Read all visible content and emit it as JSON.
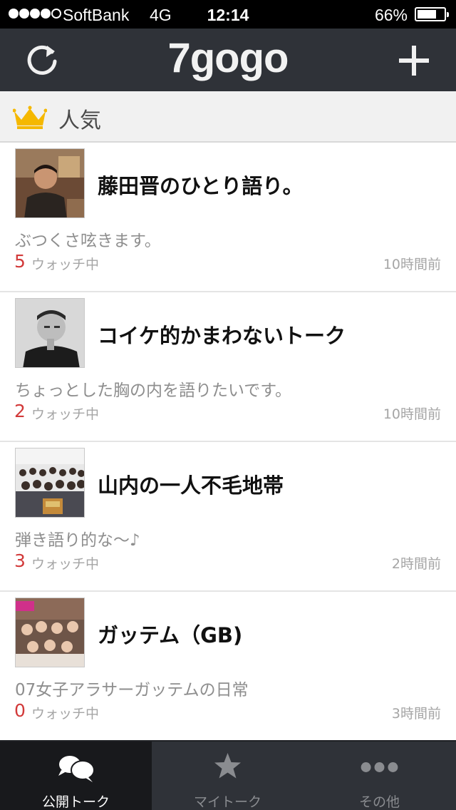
{
  "status_bar": {
    "carrier": "SoftBank",
    "network": "4G",
    "time": "12:14",
    "battery": "66%",
    "battery_level": 0.66,
    "signal_bars": 4,
    "signal_max": 5
  },
  "nav": {
    "logo": "7gogo",
    "refresh_icon": "refresh-icon",
    "add_icon": "plus-icon"
  },
  "section": {
    "icon": "crown-icon",
    "title": "人気",
    "icon_color": "#f5b800"
  },
  "talks": [
    {
      "title": "藤田晋のひとり語り。",
      "description": "ぶつくさ呟きます。",
      "watch_count": "5",
      "watch_label": "ウォッチ中",
      "time": "10時間前",
      "thumb": "person-photo"
    },
    {
      "title": "コイケ的かまわないトーク",
      "description": "ちょっとした胸の内を語りたいです。",
      "watch_count": "2",
      "watch_label": "ウォッチ中",
      "time": "10時間前",
      "thumb": "person-photo-bw"
    },
    {
      "title": "山内の一人不毛地帯",
      "description": "弾き語り的な～♪",
      "watch_count": "3",
      "watch_label": "ウォッチ中",
      "time": "2時間前",
      "thumb": "group-photo"
    },
    {
      "title": "ガッテム（GB)",
      "description": "07女子アラサーガッテムの日常",
      "watch_count": "0",
      "watch_label": "ウォッチ中",
      "time": "3時間前",
      "thumb": "group-photo-pink"
    }
  ],
  "tabs": [
    {
      "label": "公開トーク",
      "icon": "speech-bubbles-icon",
      "active": true
    },
    {
      "label": "マイトーク",
      "icon": "star-icon",
      "active": false
    },
    {
      "label": "その他",
      "icon": "more-dots-icon",
      "active": false
    }
  ],
  "colors": {
    "nav_background": "#2f3238",
    "watch_count": "#d23a3a",
    "crown": "#f5b800"
  }
}
